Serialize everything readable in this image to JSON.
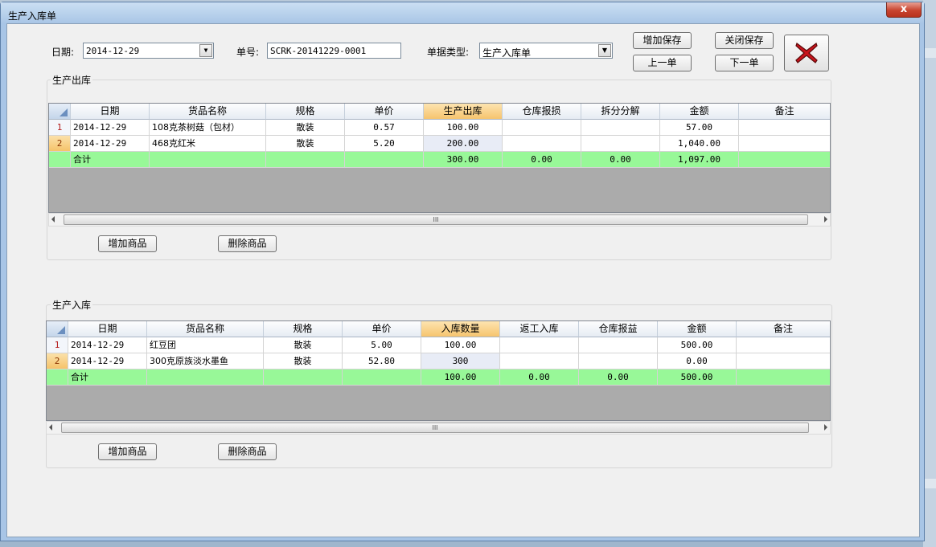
{
  "window": {
    "title": "生产入库单",
    "close_glyph": "x"
  },
  "header": {
    "date_label": "日期:",
    "date_value": "2014-12-29",
    "number_label": "单号:",
    "number_value": "SCRK-20141229-0001",
    "type_label": "单据类型:",
    "type_value": "生产入库单"
  },
  "buttons": {
    "add_save": "增加保存",
    "close_save": "关闭保存",
    "prev": "上一单",
    "next": "下一单",
    "cancel_icon": "red-x-icon"
  },
  "output_section": {
    "title": "生产出库",
    "columns": [
      "日期",
      "货品名称",
      "规格",
      "单价",
      "生产出库",
      "仓库报损",
      "拆分分解",
      "金额",
      "备注"
    ],
    "rows": [
      {
        "num": "1",
        "cells": [
          "2014-12-29",
          "108克茶树菇（包材）",
          "散装",
          "0.57",
          "100.00",
          "",
          "",
          "57.00",
          ""
        ]
      },
      {
        "num": "2",
        "cells": [
          "2014-12-29",
          "468克红米",
          "散装",
          "5.20",
          "200.00",
          "",
          "",
          "1,040.00",
          ""
        ]
      }
    ],
    "total": {
      "label": "合计",
      "cells": [
        "",
        "",
        "",
        "300.00",
        "0.00",
        "0.00",
        "1,097.00",
        ""
      ]
    },
    "add_btn": "增加商品",
    "del_btn": "删除商品",
    "scroll_grip": "III"
  },
  "input_section": {
    "title": "生产入库",
    "columns": [
      "日期",
      "货品名称",
      "规格",
      "单价",
      "入库数量",
      "返工入库",
      "仓库报益",
      "金额",
      "备注"
    ],
    "rows": [
      {
        "num": "1",
        "cells": [
          "2014-12-29",
          "红豆团",
          "散装",
          "5.00",
          "100.00",
          "",
          "",
          "500.00",
          ""
        ]
      },
      {
        "num": "2",
        "cells": [
          "2014-12-29",
          "300克原族淡水墨鱼",
          "散装",
          "52.80",
          "300",
          "",
          "",
          "0.00",
          ""
        ]
      }
    ],
    "total": {
      "label": "合计",
      "cells": [
        "",
        "",
        "",
        "100.00",
        "0.00",
        "0.00",
        "500.00",
        ""
      ]
    },
    "add_btn": "增加商品",
    "del_btn": "删除商品",
    "scroll_grip": "III"
  },
  "colors": {
    "total_row": "#98f898",
    "sorted_header": "#f6c46e",
    "grid_empty": "#ababab",
    "cancel_x": "#c8141c"
  }
}
